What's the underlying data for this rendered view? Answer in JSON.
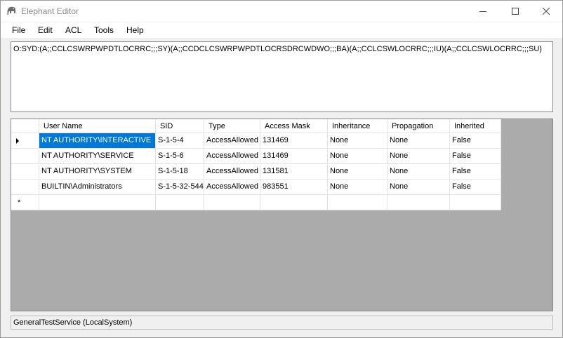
{
  "window": {
    "title": "Elephant Editor"
  },
  "menu": {
    "file": "File",
    "edit": "Edit",
    "acl": "ACL",
    "tools": "Tools",
    "help": "Help"
  },
  "sddl": {
    "text": "O:SYD:(A;;CCLCSWRPWPDTLOCRRC;;;SY)(A;;CCDCLCSWRPWPDTLOCRSDRCWDWO;;;BA)(A;;CCLCSWLOCRRC;;;IU)(A;;CCLCSWLOCRRC;;;SU)"
  },
  "grid": {
    "columns": [
      "User Name",
      "SID",
      "Type",
      "Access Mask",
      "Inheritance",
      "Propagation",
      "Inherited"
    ],
    "rows": [
      [
        "NT AUTHORITY\\INTERACTIVE",
        "S-1-5-4",
        "AccessAllowed",
        "131469",
        "None",
        "None",
        "False"
      ],
      [
        "NT AUTHORITY\\SERVICE",
        "S-1-5-6",
        "AccessAllowed",
        "131469",
        "None",
        "None",
        "False"
      ],
      [
        "NT AUTHORITY\\SYSTEM",
        "S-1-5-18",
        "AccessAllowed",
        "131581",
        "None",
        "None",
        "False"
      ],
      [
        "BUILTIN\\Administrators",
        "S-1-5-32-544",
        "AccessAllowed",
        "983551",
        "None",
        "None",
        "False"
      ]
    ],
    "new_row_marker": "*"
  },
  "status": {
    "text": "GeneralTestService (LocalSystem)"
  },
  "icons": {
    "app": "elephant-icon",
    "minimize": "minimize-icon",
    "maximize": "maximize-icon",
    "close": "close-icon",
    "current_row": "row-pointer-icon"
  },
  "colors": {
    "selection": "#0078d7",
    "grid_background": "#ababab"
  }
}
